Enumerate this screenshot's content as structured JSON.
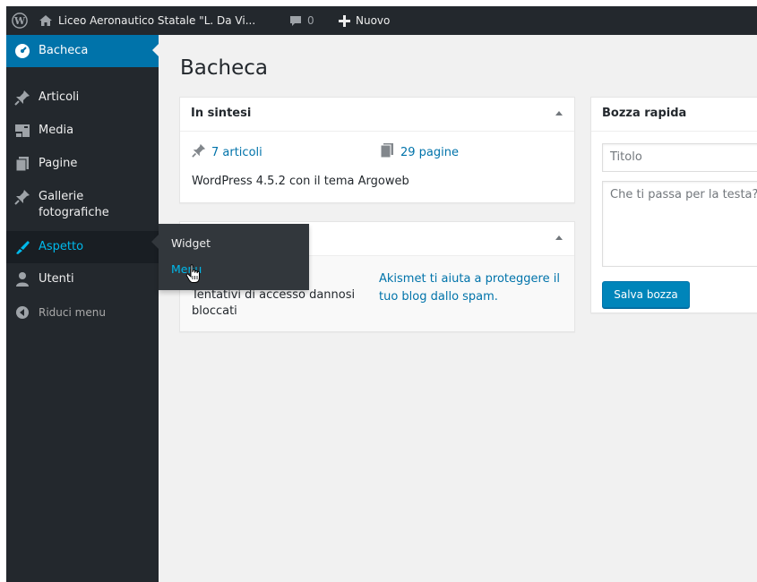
{
  "adminbar": {
    "site_name": "Liceo Aeronautico Statale \"L. Da Vi...",
    "comments_count": "0",
    "new_label": "Nuovo"
  },
  "sidebar": {
    "items": [
      {
        "label": "Bacheca",
        "icon": "dashboard-icon",
        "state": "current"
      },
      {
        "label": "Articoli",
        "icon": "pin-icon"
      },
      {
        "label": "Media",
        "icon": "media-icon"
      },
      {
        "label": "Pagine",
        "icon": "page-icon"
      },
      {
        "label": "Gallerie fotografiche",
        "label_line1": "Gallerie",
        "label_line2": "fotografiche",
        "icon": "pin-icon"
      },
      {
        "label": "Aspetto",
        "icon": "appearance-icon",
        "state": "hover"
      },
      {
        "label": "Utenti",
        "icon": "users-icon"
      }
    ],
    "collapse_label": "Riduci menu",
    "flyout": {
      "items": [
        {
          "label": "Widget"
        },
        {
          "label": "Menu",
          "state": "hover"
        }
      ]
    }
  },
  "main": {
    "page_title": "Bacheca",
    "at_a_glance": {
      "title": "In sintesi",
      "posts_link": "7 articoli",
      "pages_link": "29 pagine",
      "version_text": "WordPress 4.5.2 con il tema Argoweb"
    },
    "activity": {
      "blocked_text_line1": "Tentativi di accesso dannosi",
      "blocked_text_line2": "bloccati",
      "akismet_line1": "Akismet ti aiuta a proteggere il",
      "akismet_line2": "tuo blog dallo spam."
    },
    "quick_draft": {
      "title": "Bozza rapida",
      "title_placeholder": "Titolo",
      "content_placeholder": "Che ti passa per la testa?",
      "save_label": "Salva bozza"
    }
  },
  "colors": {
    "adminbar_bg": "#23282d",
    "accent": "#0073aa",
    "hover_text": "#00b9eb",
    "button": "#0085ba"
  }
}
